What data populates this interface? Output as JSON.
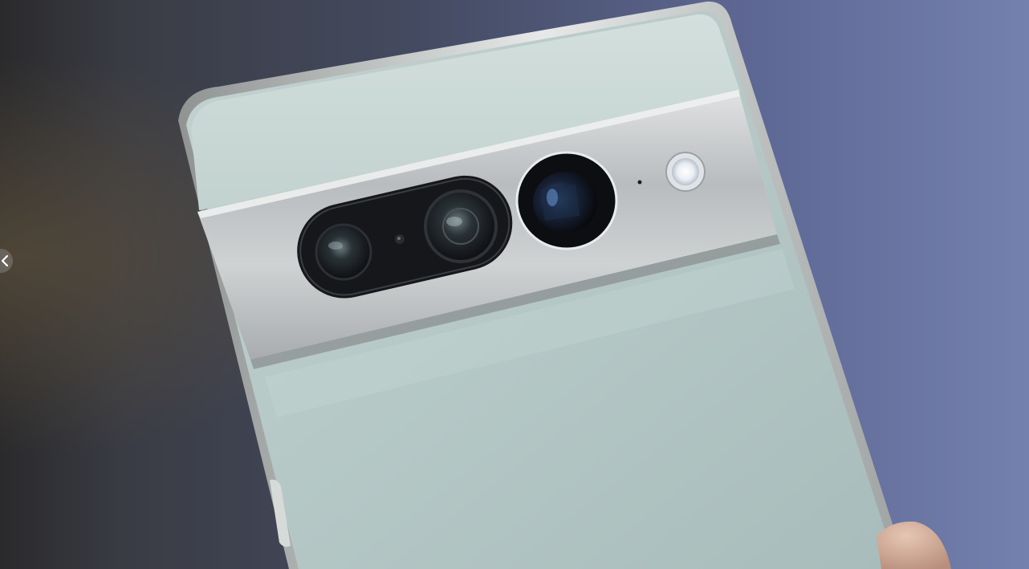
{
  "photo": {
    "subject_icon": "phone-camera-bar-photo-icon",
    "colors": {
      "phone_body": "#b7c9c7",
      "phone_top_glass": "#c9d7d4",
      "camera_bar_metal": "#c8cacc",
      "lens_visor": "#141518",
      "background_left": "#262a33",
      "background_right": "#6f7aa6",
      "thumb": "#d8b8a6"
    }
  },
  "carousel": {
    "prev_icon": "chevron-left-icon"
  }
}
